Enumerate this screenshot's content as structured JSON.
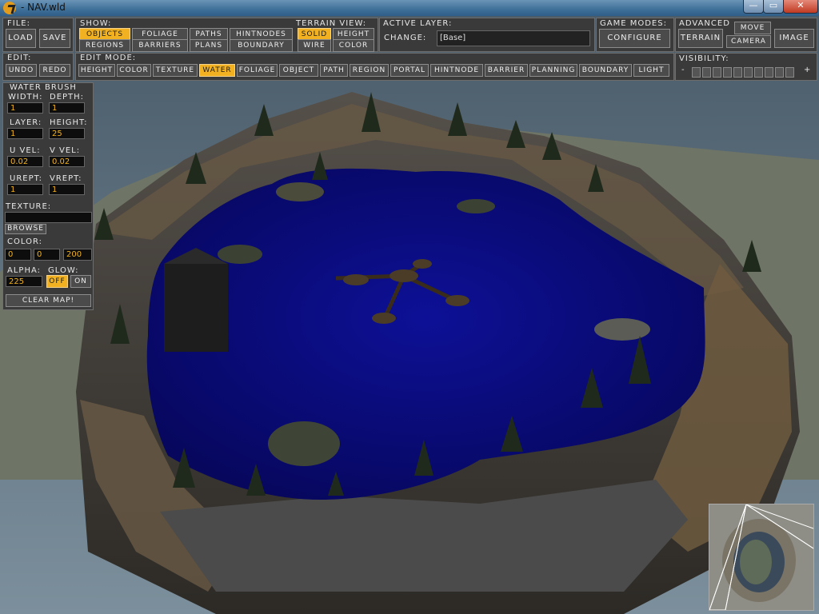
{
  "window": {
    "title": "- NAV.wld",
    "controls": {
      "minimize": "—",
      "maximize": "▭",
      "close": "✕"
    }
  },
  "file": {
    "label": "File:",
    "load": "Load",
    "save": "Save"
  },
  "show": {
    "label": "Show:",
    "buttons": [
      "Objects",
      "Foliage",
      "Paths",
      "HintNodes",
      "Regions",
      "Barriers",
      "Plans",
      "Boundary"
    ],
    "active": "Objects"
  },
  "terrain_view": {
    "label": "Terrain View:",
    "buttons": [
      "Solid",
      "Height",
      "Wire",
      "Color"
    ],
    "active": "Solid"
  },
  "active_layer": {
    "label": "Active Layer:",
    "change": "Change:",
    "value": "[Base]"
  },
  "game_modes": {
    "label": "Game Modes:",
    "configure": "Configure"
  },
  "advanced": {
    "label": "Advanced",
    "move": "Move",
    "terrain": "Terrain",
    "camera": "Camera",
    "image": "Image"
  },
  "edit": {
    "label": "Edit:",
    "undo": "Undo",
    "redo": "Redo"
  },
  "edit_mode": {
    "label": "Edit Mode:",
    "buttons": [
      "Height",
      "Color",
      "Texture",
      "Water",
      "Foliage",
      "Object",
      "Path",
      "Region",
      "Portal",
      "HintNode",
      "Barrier",
      "Planning",
      "Boundary",
      "Light"
    ],
    "active": "Water"
  },
  "visibility": {
    "label": "Visibility:",
    "minus": "-",
    "plus": "+",
    "boxes": 10
  },
  "water_brush": {
    "title": "Water Brush",
    "width_label": "Width:",
    "width": "1",
    "depth_label": "Depth:",
    "depth": "1",
    "layer_label": "Layer:",
    "layer": "1",
    "height_label": "Height:",
    "height": "25",
    "uvel_label": "U Vel:",
    "uvel": "0.02",
    "vvel_label": "V Vel:",
    "vvel": "0.02",
    "urept_label": "URept:",
    "urept": "1",
    "vrept_label": "VRept:",
    "vrept": "1",
    "texture_label": "Texture:",
    "texture": "",
    "browse": "Browse",
    "color_label": "Color:",
    "color_r": "0",
    "color_g": "0",
    "color_b": "200",
    "alpha_label": "Alpha:",
    "alpha": "225",
    "glow_label": "Glow:",
    "glow_off": "Off",
    "glow_on": "On",
    "glow_active": "Off",
    "clear": "Clear Map!"
  },
  "colors": {
    "accent": "#f2b120",
    "water": "#0c0c8a",
    "panel": "#3a3a3a"
  }
}
